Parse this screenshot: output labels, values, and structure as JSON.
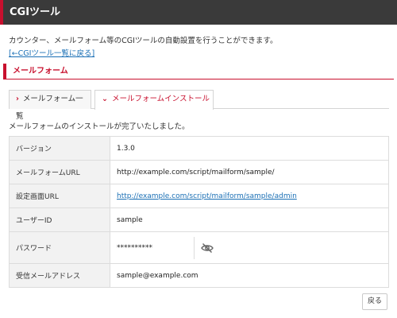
{
  "header": {
    "title": "CGIツール"
  },
  "intro": {
    "description": "カウンター、メールフォーム等のCGIツールの自動設置を行うことができます。",
    "back_link": "[←CGIツール一覧に戻る]"
  },
  "section": {
    "title": "メールフォーム"
  },
  "tabs": [
    {
      "label": "メールフォーム一覧",
      "active": false
    },
    {
      "label": "メールフォームインストール",
      "active": true
    }
  ],
  "message": "メールフォームのインストールが完了いたしました。",
  "table": {
    "version": {
      "label": "バージョン",
      "value": "1.3.0"
    },
    "form_url": {
      "label": "メールフォームURL",
      "value": "http://example.com/script/mailform/sample/"
    },
    "admin_url": {
      "label": "設定画面URL",
      "value": "http://example.com/script/mailform/sample/admin"
    },
    "user_id": {
      "label": "ユーザーID",
      "value": "sample"
    },
    "password": {
      "label": "パスワード",
      "value": "**********"
    },
    "mail": {
      "label": "受信メールアドレス",
      "value": "sample@example.com"
    }
  },
  "footer": {
    "back_button": "戻る"
  },
  "colors": {
    "accent": "#c8102e",
    "header_bg": "#3a3a3a",
    "link": "#1a6fb5"
  }
}
